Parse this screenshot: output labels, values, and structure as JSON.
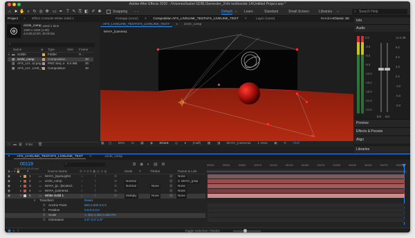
{
  "window": {
    "title": "Adobe After Effects 2020 - /Volumes/Isabel GDBL/Semester_2/vfx toolbox/wk 14/Untitled Project.aep *"
  },
  "toolbar": {
    "snapping_label": "Snapping",
    "workspaces": [
      "Default",
      "Learn",
      "Standard",
      "Small Screen",
      "Libraries"
    ],
    "search_placeholder": "Search Help"
  },
  "project_panel": {
    "tabs": [
      "Project",
      "Effect Controls White Solid 1"
    ],
    "item_name": "circle_comp",
    "item_used": ", used 1 time",
    "item_size": "1000 x 1000 (1.00)",
    "item_duration": "Δ 0;00;10;00, 30.00 fps",
    "columns": {
      "name": "Name",
      "type": "Type",
      "size": "Size",
      "fps": "Frame R..."
    },
    "rows": [
      {
        "name": "Solids",
        "type": "Folder",
        "size": "",
        "fps": ""
      },
      {
        "name": "circle_comp",
        "type": "Composition",
        "size": "",
        "fps": "30"
      },
      {
        "name": "AFX_LIV...t2.png",
        "type": "PNG Seq..e",
        "size": "8.0 MB",
        "fps": "30"
      },
      {
        "name": "AFX_LIV...LIVE_TE",
        "type": "Composition",
        "size": "",
        "fps": "30"
      }
    ],
    "bpc": "8 bpc"
  },
  "viewer": {
    "tabs_top": [
      "Footage (none)",
      "Composition AFX_LIVELINK_TESTAFX_LIVELINK_TEST",
      "Layer (none)"
    ],
    "sub_tabs": [
      "AFX_LIVELINK_TESTAFX_LIVELINK_TEST",
      "circle_comp"
    ],
    "renderer_label": "Renderer:",
    "renderer_value": "Classic 3D",
    "camera_label": "MAYA_|camera1",
    "footer": {
      "zoom": "50%",
      "timecode": "00119",
      "resolution": "(Half)",
      "camera": "MAYA_|camera1",
      "view": "1 View",
      "exposure": "+0.0"
    }
  },
  "right_panel": {
    "info_label": "Info",
    "audio_label": "Audio",
    "meter_scale": [
      "0.0",
      "-3.0",
      "-6.0",
      "-9.0",
      "-12.0",
      "-15.0",
      "-18.0",
      "-21.0",
      "-24.0"
    ],
    "right_scale": [
      "12.0 dB",
      "6.0",
      "0.0",
      "-6.0",
      "-12.0",
      "-18.0",
      "-24.0"
    ],
    "db_values": [
      "0.0",
      "0.0"
    ],
    "right_scale_top": [
      "12.0 dB",
      "9.0",
      "6.0",
      "3.0",
      "0.0",
      "-3.0",
      "-6.0",
      "-9.0"
    ],
    "sections": [
      "Preview",
      "Effects & Presets",
      "Align",
      "Libraries"
    ]
  },
  "timeline": {
    "tabs": [
      "AFX_LIVELINK_TESTAFX_LIVELINK_TEST",
      "circle_comp"
    ],
    "timecode": "00119",
    "timecode_sub": "0;00;03;29 (30.00 fps)",
    "columns": {
      "source": "Source Name",
      "mode": "Mode",
      "trkmat": "TrkMat",
      "parent": "Parent & Link"
    },
    "ruler": [
      "00000",
      "00025",
      "00050",
      "00075",
      "00100",
      "00125",
      "00150",
      "00175",
      "00200",
      "00225",
      "00250",
      "00275",
      "0030"
    ],
    "layers": [
      {
        "num": "1",
        "name": "MAYA_|spotLight1",
        "mode": "",
        "trkmat": "",
        "parent": "None",
        "color": "#c9a24a"
      },
      {
        "num": "2",
        "name": "circle_comp",
        "mode": "Normal",
        "trkmat": "",
        "parent": "3. MAYA_|pSp",
        "color": "#b25a5a"
      },
      {
        "num": "3",
        "name": "MAYA_|p...|locator1",
        "mode": "Normal",
        "trkmat": "None",
        "parent": "None",
        "color": "#b25a5a"
      },
      {
        "num": "4",
        "name": "MAYA_|camera1",
        "mode": "",
        "trkmat": "",
        "parent": "None",
        "color": "#b25a5a"
      },
      {
        "num": "5",
        "name": "White Solid 1",
        "mode": "Multiply",
        "trkmat": "None",
        "parent": "None",
        "color": "#c8c8c8"
      }
    ],
    "transform_label": "Transform",
    "reset_label": "Reset",
    "properties": [
      {
        "name": "Anchor Point",
        "value": "500.0,500.0,0.0"
      },
      {
        "name": "Position",
        "value": "0.0,0.0,0.0"
      },
      {
        "name": "Scale",
        "value": "∞ 482.0,482.0,482.0%"
      },
      {
        "name": "Orientation",
        "value": "0.0°,0.0°,0.0°"
      }
    ],
    "footer_label": "Toggle Switches / Modes"
  },
  "colors": {
    "accent": "#2d8ceb",
    "timecode": "#4aa3ff",
    "layer_red": "#8f3b3b",
    "layer_pink": "#a55a5a"
  }
}
